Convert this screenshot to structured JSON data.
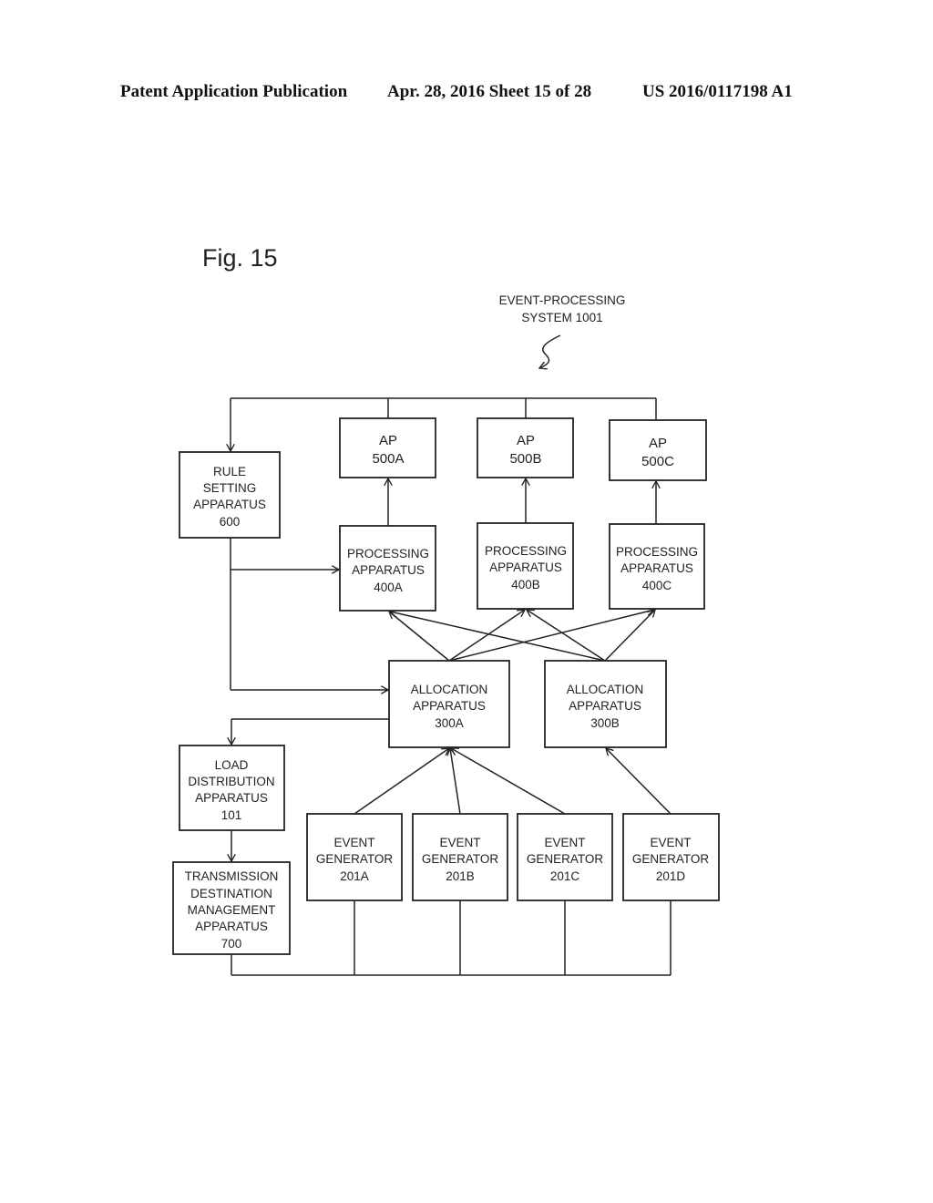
{
  "header": {
    "left": "Patent Application Publication",
    "middle": "Apr. 28, 2016  Sheet 15 of 28",
    "right": "US 2016/0117198 A1"
  },
  "figure": {
    "label": "Fig. 15",
    "system_label_line1": "EVENT-PROCESSING",
    "system_label_line2": "SYSTEM 1001"
  },
  "nodes": {
    "rule": [
      "RULE",
      "SETTING",
      "APPARATUS",
      "600"
    ],
    "ap_a": [
      "AP",
      "500A"
    ],
    "ap_b": [
      "AP",
      "500B"
    ],
    "ap_c": [
      "AP",
      "500C"
    ],
    "proc_a": [
      "PROCESSING",
      "APPARATUS",
      "400A"
    ],
    "proc_b": [
      "PROCESSING",
      "APPARATUS",
      "400B"
    ],
    "proc_c": [
      "PROCESSING",
      "APPARATUS",
      "400C"
    ],
    "alloc_a": [
      "ALLOCATION",
      "APPARATUS",
      "300A"
    ],
    "alloc_b": [
      "ALLOCATION",
      "APPARATUS",
      "300B"
    ],
    "load": [
      "LOAD",
      "DISTRIBUTION",
      "APPARATUS",
      "101"
    ],
    "trans": [
      "TRANSMISSION",
      "DESTINATION",
      "MANAGEMENT",
      "APPARATUS",
      "700"
    ],
    "eg_a": [
      "EVENT",
      "GENERATOR",
      "201A"
    ],
    "eg_b": [
      "EVENT",
      "GENERATOR",
      "201B"
    ],
    "eg_c": [
      "EVENT",
      "GENERATOR",
      "201C"
    ],
    "eg_d": [
      "EVENT",
      "GENERATOR",
      "201D"
    ]
  },
  "edges": [
    {
      "from": "ap_a",
      "to": "rule",
      "type": "bus"
    },
    {
      "from": "ap_b",
      "to": "rule",
      "type": "bus"
    },
    {
      "from": "ap_c",
      "to": "rule",
      "type": "bus"
    },
    {
      "from": "rule",
      "to": "proc_a"
    },
    {
      "from": "rule",
      "to": "alloc_a"
    },
    {
      "from": "proc_a",
      "to": "ap_a"
    },
    {
      "from": "proc_b",
      "to": "ap_b"
    },
    {
      "from": "proc_c",
      "to": "ap_c"
    },
    {
      "from": "alloc_a",
      "to": "proc_a"
    },
    {
      "from": "alloc_a",
      "to": "proc_b"
    },
    {
      "from": "alloc_a",
      "to": "proc_c"
    },
    {
      "from": "alloc_b",
      "to": "proc_a"
    },
    {
      "from": "alloc_b",
      "to": "proc_b"
    },
    {
      "from": "alloc_b",
      "to": "proc_c"
    },
    {
      "from": "alloc_a",
      "to": "load"
    },
    {
      "from": "load",
      "to": "trans"
    },
    {
      "from": "eg_a",
      "to": "alloc_a"
    },
    {
      "from": "eg_b",
      "to": "alloc_a"
    },
    {
      "from": "eg_c",
      "to": "alloc_a"
    },
    {
      "from": "eg_d",
      "to": "alloc_b"
    },
    {
      "from": "trans",
      "to": "eg_a",
      "type": "bus"
    },
    {
      "from": "trans",
      "to": "eg_b",
      "type": "bus"
    },
    {
      "from": "trans",
      "to": "eg_c",
      "type": "bus"
    },
    {
      "from": "trans",
      "to": "eg_d",
      "type": "bus"
    }
  ]
}
